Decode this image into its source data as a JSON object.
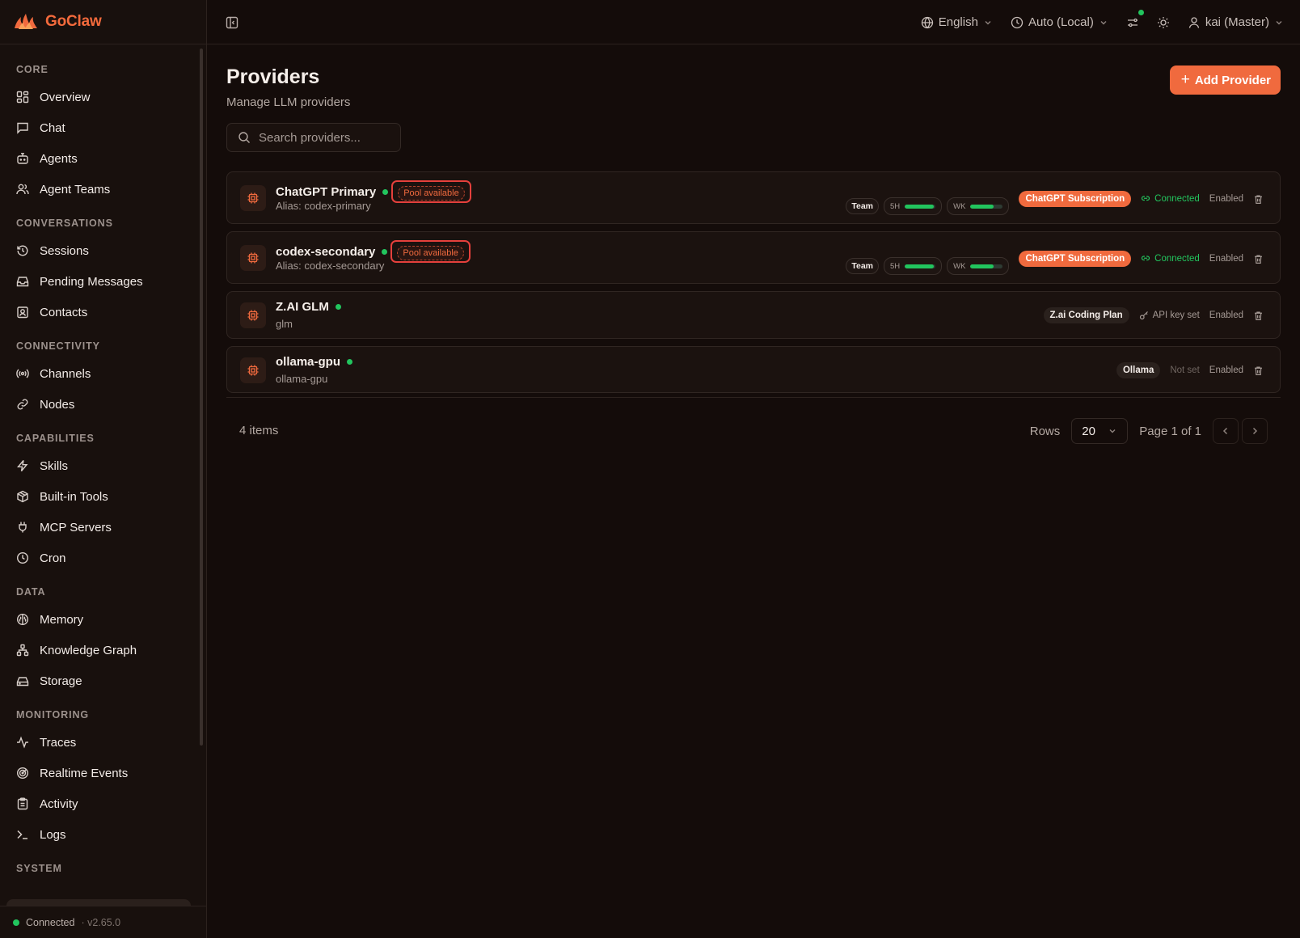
{
  "brand": {
    "name": "GoClaw"
  },
  "sidebar": {
    "sections": [
      {
        "title": "CORE",
        "items": [
          {
            "label": "Overview",
            "icon": "grid-icon"
          },
          {
            "label": "Chat",
            "icon": "message-square-icon"
          },
          {
            "label": "Agents",
            "icon": "bot-icon"
          },
          {
            "label": "Agent Teams",
            "icon": "users-icon"
          }
        ]
      },
      {
        "title": "CONVERSATIONS",
        "items": [
          {
            "label": "Sessions",
            "icon": "history-icon"
          },
          {
            "label": "Pending Messages",
            "icon": "inbox-icon"
          },
          {
            "label": "Contacts",
            "icon": "contact-icon"
          }
        ]
      },
      {
        "title": "CONNECTIVITY",
        "items": [
          {
            "label": "Channels",
            "icon": "radio-icon"
          },
          {
            "label": "Nodes",
            "icon": "link-icon"
          }
        ]
      },
      {
        "title": "CAPABILITIES",
        "items": [
          {
            "label": "Skills",
            "icon": "zap-icon"
          },
          {
            "label": "Built-in Tools",
            "icon": "package-icon"
          },
          {
            "label": "MCP Servers",
            "icon": "plug-icon"
          },
          {
            "label": "Cron",
            "icon": "clock-icon"
          }
        ]
      },
      {
        "title": "DATA",
        "items": [
          {
            "label": "Memory",
            "icon": "brain-icon"
          },
          {
            "label": "Knowledge Graph",
            "icon": "network-icon"
          },
          {
            "label": "Storage",
            "icon": "hard-drive-icon"
          }
        ]
      },
      {
        "title": "MONITORING",
        "items": [
          {
            "label": "Traces",
            "icon": "activity-icon"
          },
          {
            "label": "Realtime Events",
            "icon": "radar-icon"
          },
          {
            "label": "Activity",
            "icon": "clipboard-icon"
          },
          {
            "label": "Logs",
            "icon": "terminal-icon"
          }
        ]
      },
      {
        "title": "SYSTEM",
        "items": []
      }
    ],
    "footer": {
      "status": "Connected",
      "version": "· v2.65.0"
    }
  },
  "topbar": {
    "language": "English",
    "timezone": "Auto (Local)",
    "user": "kai (Master)"
  },
  "page": {
    "title": "Providers",
    "subtitle": "Manage LLM providers",
    "add_button": "Add Provider",
    "search_placeholder": "Search providers..."
  },
  "providers": [
    {
      "name": "ChatGPT Primary",
      "subtitle": "Alias: codex-primary",
      "pool_badge": "Pool available",
      "team": "Team",
      "meter_5h": {
        "label": "5H",
        "fill": 0.95
      },
      "meter_wk": {
        "label": "WK",
        "fill": 0.72
      },
      "type": "ChatGPT Subscription",
      "connection": "Connected",
      "state": "Enabled"
    },
    {
      "name": "codex-secondary",
      "subtitle": "Alias: codex-secondary",
      "pool_badge": "Pool available",
      "team": "Team",
      "meter_5h": {
        "label": "5H",
        "fill": 0.95
      },
      "meter_wk": {
        "label": "WK",
        "fill": 0.72
      },
      "type": "ChatGPT Subscription",
      "connection": "Connected",
      "state": "Enabled"
    },
    {
      "name": "Z.AI GLM",
      "subtitle": "glm",
      "type": "Z.ai Coding Plan",
      "key_status": "API key set",
      "state": "Enabled"
    },
    {
      "name": "ollama-gpu",
      "subtitle": "ollama-gpu",
      "type": "Ollama",
      "key_status": "Not set",
      "state": "Enabled"
    }
  ],
  "pagination": {
    "count": "4 items",
    "rows_label": "Rows",
    "rows_value": "20",
    "page_info": "Page 1 of 1"
  },
  "colors": {
    "accent": "#f06a3e",
    "status_green": "#22c55e",
    "highlight_red": "#e5403c"
  }
}
